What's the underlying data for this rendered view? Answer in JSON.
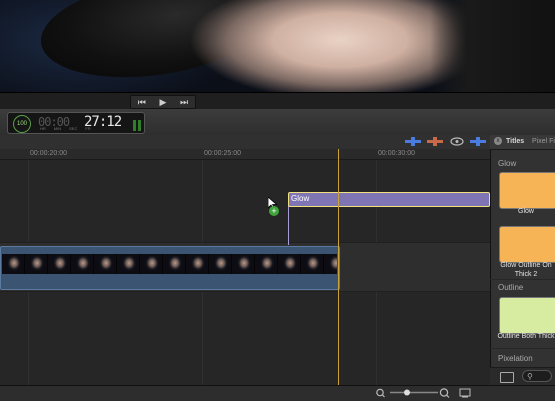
{
  "transport": {
    "prev_icon": "skip-back-icon",
    "play_icon": "play-icon",
    "next_icon": "skip-forward-icon"
  },
  "dashboard": {
    "badge": "100",
    "timecode_faint": "00:00",
    "timecode": "27:12",
    "unit_labels": [
      "HR",
      "MIN",
      "SEC",
      "FR"
    ]
  },
  "ruler": {
    "ticks": [
      "00:00:20:00",
      "00:00:25:00",
      "00:00:30:00"
    ]
  },
  "timeline": {
    "title_clip": "Glow"
  },
  "browser": {
    "tab_titles": "Titles",
    "tab_pixel": "Pixel Fi",
    "sections": [
      {
        "label": "Glow",
        "items": [
          {
            "label": "Glow",
            "color": "#f6b457"
          },
          {
            "label": "Glow Outline On Thick 2",
            "color": "#f6b457"
          }
        ]
      },
      {
        "label": "Outline",
        "items": [
          {
            "label": "Outline Both Thick",
            "color": "#d7eca0"
          }
        ]
      },
      {
        "label": "Pixelation"
      }
    ]
  },
  "colors": {
    "playhead": "#c9a23a",
    "title_clip": "#7f74b4",
    "video_clip": "#3a5472"
  }
}
